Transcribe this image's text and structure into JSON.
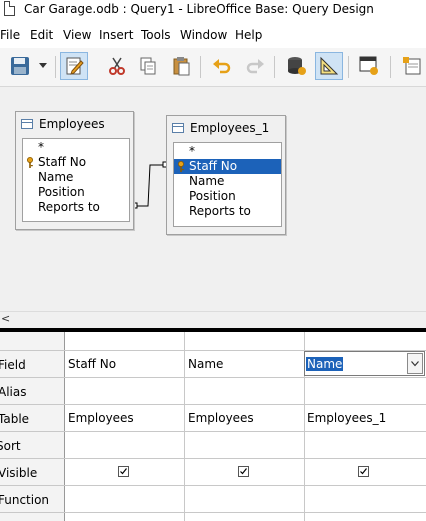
{
  "window": {
    "title": "Car Garage.odb : Query1 - LibreOffice Base: Query Design"
  },
  "menu": {
    "items": [
      "File",
      "Edit",
      "View",
      "Insert",
      "Tools",
      "Window",
      "Help"
    ]
  },
  "toolbar": {
    "buttons": [
      "save-icon",
      "dropdown-arrow-icon",
      "edit-mode-icon",
      "cut-icon",
      "copy-icon",
      "paste-icon",
      "undo-icon",
      "redo-icon",
      "run-query-icon",
      "design-view-icon",
      "add-table-icon",
      "function-icon",
      "add-field-icon"
    ],
    "active": [
      "edit-mode-icon",
      "design-view-icon"
    ]
  },
  "tables": [
    {
      "name": "Employees",
      "fields": [
        "*",
        "Staff No",
        "Name",
        "Position",
        "Reports to"
      ],
      "key_field": "Staff No",
      "selected_field": ""
    },
    {
      "name": "Employees_1",
      "fields": [
        "*",
        "Staff No",
        "Name",
        "Position",
        "Reports to"
      ],
      "key_field": "Staff No",
      "selected_field": "Staff No"
    }
  ],
  "grid": {
    "row_labels": [
      "Field",
      "Alias",
      "Table",
      "Sort",
      "Visible",
      "Function"
    ],
    "columns": [
      {
        "field": "Staff No",
        "alias": "",
        "table": "Employees",
        "sort": "",
        "visible": true,
        "function": ""
      },
      {
        "field": "Name",
        "alias": "",
        "table": "Employees",
        "sort": "",
        "visible": true,
        "function": ""
      },
      {
        "field": "Name",
        "alias": "",
        "table": "Employees_1",
        "sort": "",
        "visible": true,
        "function": ""
      }
    ]
  },
  "colors": {
    "selection": "#1c62b9",
    "toolbar_bg": "#f5f5f5",
    "design_bg": "#f0f0f0"
  }
}
